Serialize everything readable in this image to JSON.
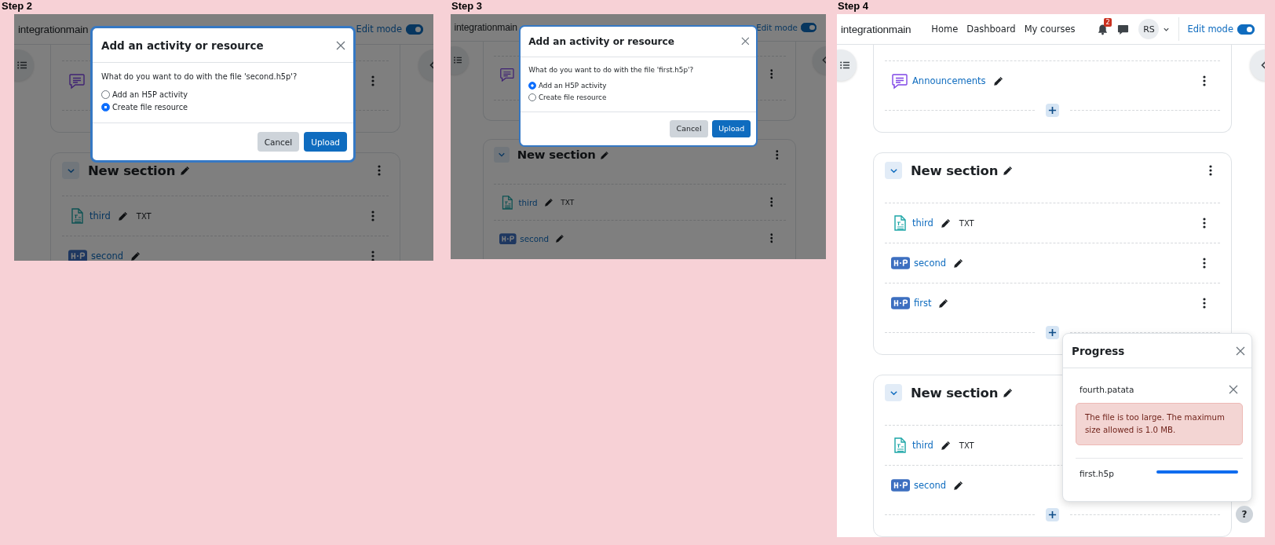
{
  "panels": [
    {
      "caption": "Step 2",
      "header": {
        "brand": "integrationmain",
        "edit_mode": {
          "label": "Edit mode",
          "on": true
        }
      },
      "sections": [
        {
          "kind": "general",
          "items": [
            {
              "kind": "forum"
            }
          ]
        },
        {
          "kind": "section",
          "title": "New section",
          "items": [
            {
              "kind": "file",
              "name": "third",
              "extension": "TXT"
            },
            {
              "kind": "h5p",
              "name": "second"
            }
          ]
        }
      ],
      "dialog": {
        "title": "Add an activity or resource",
        "question": "What do you want to do with the file 'second.h5p'?",
        "options": [
          {
            "label": "Add an H5P activity",
            "selected": false
          },
          {
            "label": "Create file resource",
            "selected": true
          }
        ],
        "buttons": [
          {
            "label": "Cancel",
            "kind": "secondary"
          },
          {
            "label": "Upload",
            "kind": "primary"
          }
        ]
      }
    },
    {
      "caption": "Step 3",
      "header": {
        "brand": "integrationmain",
        "edit_mode": {
          "label": "Edit mode",
          "on": true
        }
      },
      "sections": [
        {
          "kind": "general",
          "items": [
            {
              "kind": "forum"
            }
          ]
        },
        {
          "kind": "section",
          "title": "New section",
          "items": [
            {
              "kind": "file",
              "name": "third",
              "extension": "TXT"
            },
            {
              "kind": "h5p",
              "name": "second"
            }
          ]
        }
      ],
      "dialog": {
        "title": "Add an activity or resource",
        "question": "What do you want to do with the file 'first.h5p'?",
        "options": [
          {
            "label": "Add an H5P activity",
            "selected": true
          },
          {
            "label": "Create file resource",
            "selected": false
          }
        ],
        "buttons": [
          {
            "label": "Cancel",
            "kind": "secondary"
          },
          {
            "label": "Upload",
            "kind": "primary"
          }
        ]
      }
    },
    {
      "caption": "Step 4",
      "header": {
        "brand": "integrationmain",
        "links": [
          "Home",
          "Dashboard",
          "My courses"
        ],
        "notifications": "2",
        "avatar": "RS",
        "edit_mode": {
          "label": "Edit mode",
          "on": true
        }
      },
      "sections": [
        {
          "kind": "general",
          "items": [
            {
              "kind": "forum",
              "name": "Announcements"
            }
          ],
          "add_button": true
        },
        {
          "kind": "section",
          "title": "New section",
          "items": [
            {
              "kind": "file",
              "name": "third",
              "extension": "TXT"
            },
            {
              "kind": "h5p",
              "name": "second"
            },
            {
              "kind": "h5p",
              "name": "first"
            }
          ],
          "add_button": true
        },
        {
          "kind": "section",
          "title": "New section",
          "items": [
            {
              "kind": "file",
              "name": "third",
              "extension": "TXT"
            },
            {
              "kind": "h5p",
              "name": "second"
            }
          ],
          "add_button": true
        }
      ],
      "progress": {
        "title": "Progress",
        "uploads": [
          {
            "kind": "error",
            "file": "fourth.patata",
            "message": "The file is too large. The maximum size allowed is 1.0 MB."
          },
          {
            "kind": "progress",
            "file": "first.h5p",
            "level": 1
          }
        ]
      },
      "help_button": "?"
    }
  ]
}
